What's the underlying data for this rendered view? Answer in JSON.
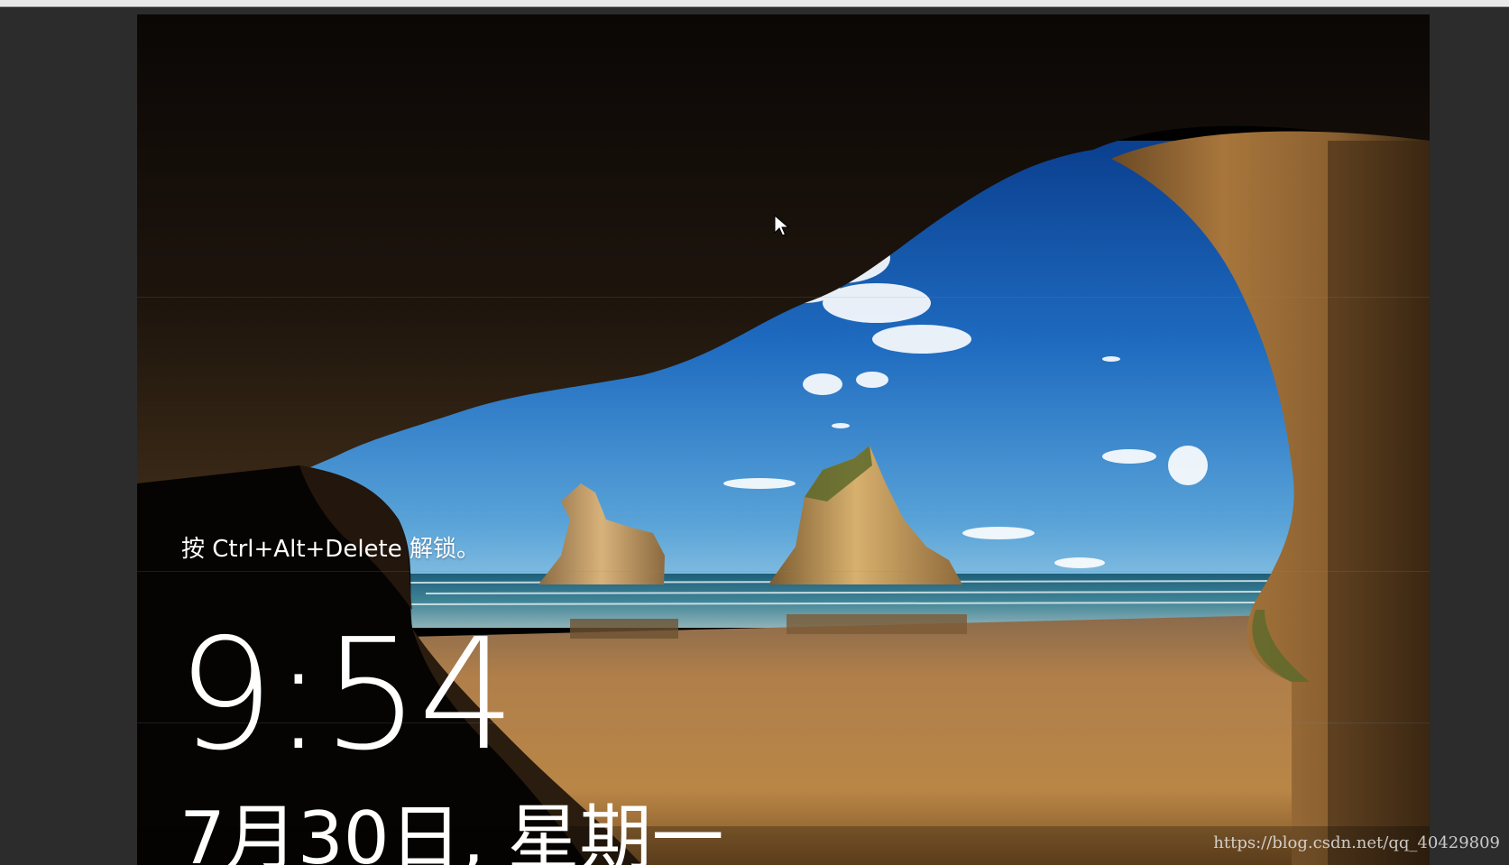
{
  "lock_screen": {
    "unlock_hint": "按 Ctrl+Alt+Delete 解锁。",
    "time": "9:54",
    "date": "7月30日, 星期一"
  },
  "watermark": {
    "text": "https://blog.csdn.net/qq_40429809"
  },
  "icons": {
    "cursor": "mouse-pointer-icon"
  },
  "colors": {
    "text": "#ffffff",
    "frame": "#2c2c2c",
    "sky": "#1d63b8",
    "sand": "#b78447"
  }
}
